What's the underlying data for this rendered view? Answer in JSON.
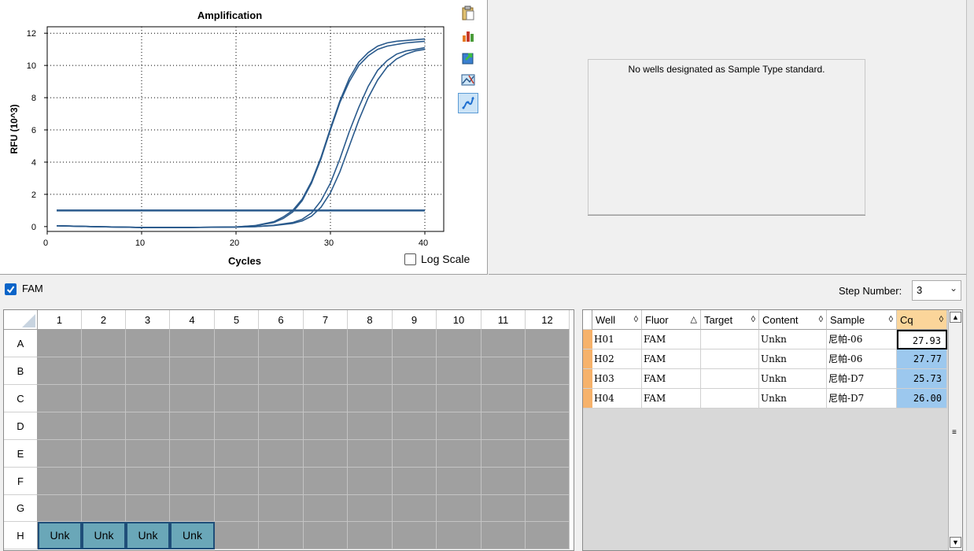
{
  "chart": {
    "title": "Amplification",
    "xlabel": "Cycles",
    "ylabel": "RFU (10^3)",
    "log_scale_label": "Log Scale",
    "x_ticks": [
      "0",
      "10",
      "20",
      "30",
      "40"
    ],
    "y_ticks": [
      "0",
      "2",
      "4",
      "6",
      "8",
      "10",
      "12"
    ]
  },
  "chart_data": {
    "type": "line",
    "xlim": [
      0,
      42
    ],
    "ylim": [
      -0.3,
      12.4
    ],
    "grid": true,
    "threshold": 1.0,
    "series_color": "#2a5a8c",
    "series": [
      {
        "x": [
          1,
          5,
          10,
          15,
          20,
          22,
          24,
          25,
          26,
          27,
          28,
          29,
          30,
          31,
          32,
          33,
          34,
          35,
          36,
          37,
          38,
          39,
          40
        ],
        "values": [
          0.05,
          0.0,
          -0.05,
          -0.05,
          -0.02,
          0.05,
          0.25,
          0.5,
          0.9,
          1.6,
          2.7,
          4.2,
          6.0,
          7.7,
          9.0,
          10.0,
          10.6,
          11.0,
          11.2,
          11.3,
          11.4,
          11.45,
          11.5
        ]
      },
      {
        "x": [
          1,
          5,
          10,
          15,
          20,
          22,
          24,
          25,
          26,
          27,
          28,
          29,
          30,
          31,
          32,
          33,
          34,
          35,
          36,
          37,
          38,
          39,
          40
        ],
        "values": [
          0.05,
          0.0,
          -0.05,
          -0.05,
          -0.02,
          0.06,
          0.3,
          0.6,
          1.0,
          1.7,
          2.8,
          4.3,
          6.1,
          7.8,
          9.2,
          10.2,
          10.8,
          11.2,
          11.4,
          11.5,
          11.55,
          11.6,
          11.65
        ]
      },
      {
        "x": [
          1,
          5,
          10,
          15,
          20,
          22,
          24,
          26,
          27,
          28,
          29,
          30,
          31,
          32,
          33,
          34,
          35,
          36,
          37,
          38,
          39,
          40
        ],
        "values": [
          0.05,
          0.0,
          -0.05,
          -0.05,
          -0.03,
          0.0,
          0.08,
          0.25,
          0.45,
          0.85,
          1.6,
          2.7,
          4.2,
          5.9,
          7.4,
          8.7,
          9.7,
          10.3,
          10.7,
          10.9,
          11.0,
          11.1
        ]
      },
      {
        "x": [
          1,
          5,
          10,
          15,
          20,
          22,
          24,
          26,
          27,
          28,
          29,
          30,
          31,
          32,
          33,
          34,
          35,
          36,
          37,
          38,
          39,
          40
        ],
        "values": [
          0.05,
          0.0,
          -0.05,
          -0.05,
          -0.03,
          0.0,
          0.06,
          0.2,
          0.35,
          0.65,
          1.2,
          2.1,
          3.4,
          5.0,
          6.6,
          8.0,
          9.1,
          9.9,
          10.4,
          10.7,
          10.9,
          11.0
        ]
      }
    ]
  },
  "toolbar": {
    "icons": [
      "clipboard-icon",
      "chart-bar-icon",
      "export-icon",
      "image-icon",
      "curve-icon"
    ]
  },
  "standard_curve": {
    "message": "No wells designated as Sample Type standard."
  },
  "fluor": {
    "name": "FAM",
    "checked": true,
    "step_label": "Step Number:",
    "step_value": "3"
  },
  "plate": {
    "columns": [
      "1",
      "2",
      "3",
      "4",
      "5",
      "6",
      "7",
      "8",
      "9",
      "10",
      "11",
      "12"
    ],
    "rows": [
      "A",
      "B",
      "C",
      "D",
      "E",
      "F",
      "G",
      "H"
    ],
    "wells": [
      {
        "row": "H",
        "col": 1,
        "label": "Unk"
      },
      {
        "row": "H",
        "col": 2,
        "label": "Unk"
      },
      {
        "row": "H",
        "col": 3,
        "label": "Unk"
      },
      {
        "row": "H",
        "col": 4,
        "label": "Unk"
      }
    ]
  },
  "results": {
    "headers": [
      {
        "label": "Well",
        "sort": "◊"
      },
      {
        "label": "Fluor",
        "sort": "△"
      },
      {
        "label": "Target",
        "sort": "◊"
      },
      {
        "label": "Content",
        "sort": "◊"
      },
      {
        "label": "Sample",
        "sort": "◊"
      },
      {
        "label": "Cq",
        "sort": "◊"
      }
    ],
    "rows": [
      {
        "well": "H01",
        "fluor": "FAM",
        "target": "",
        "content": "Unkn",
        "sample": "尼帕-06",
        "cq": "27.93"
      },
      {
        "well": "H02",
        "fluor": "FAM",
        "target": "",
        "content": "Unkn",
        "sample": "尼帕-06",
        "cq": "27.77"
      },
      {
        "well": "H03",
        "fluor": "FAM",
        "target": "",
        "content": "Unkn",
        "sample": "尼帕-D7",
        "cq": "25.73"
      },
      {
        "well": "H04",
        "fluor": "FAM",
        "target": "",
        "content": "Unkn",
        "sample": "尼帕-D7",
        "cq": "26.00"
      }
    ]
  }
}
